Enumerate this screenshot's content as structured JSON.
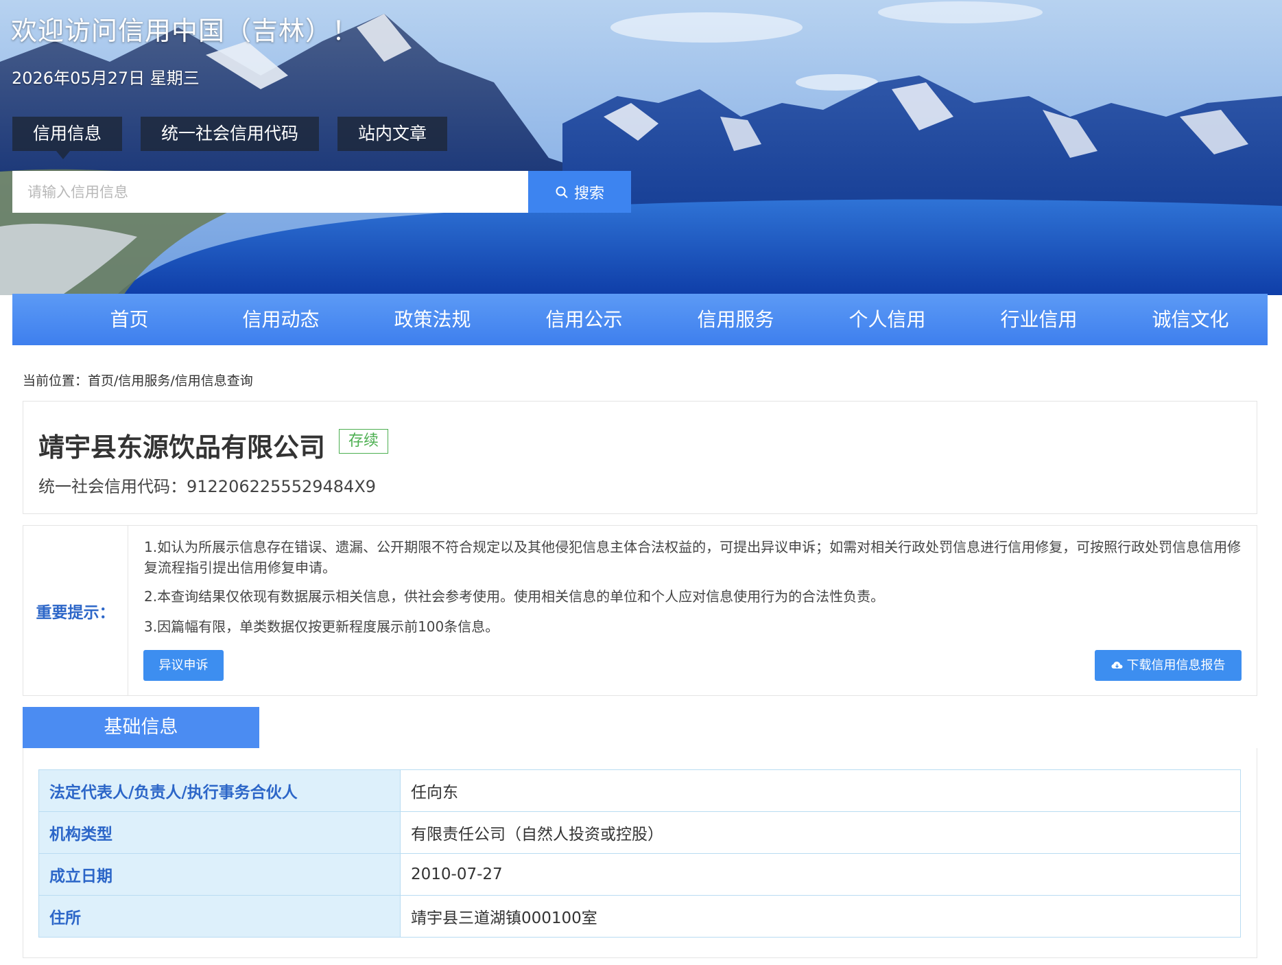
{
  "header": {
    "welcome": "欢迎访问信用中国（吉林）！",
    "date": "2026年05月27日 星期三"
  },
  "search": {
    "tabs": [
      {
        "label": "信用信息",
        "active": true
      },
      {
        "label": "统一社会信用代码",
        "active": false
      },
      {
        "label": "站内文章",
        "active": false
      }
    ],
    "placeholder": "请输入信用信息",
    "button_label": "搜索"
  },
  "nav": {
    "items": [
      "首页",
      "信用动态",
      "政策法规",
      "信用公示",
      "信用服务",
      "个人信用",
      "行业信用",
      "诚信文化"
    ]
  },
  "breadcrumb": "当前位置：首页/信用服务/信用信息查询",
  "company": {
    "name": "靖宇县东源饮品有限公司",
    "status": "存续",
    "credit_code_label": "统一社会信用代码：",
    "credit_code": "9122062255529484X9"
  },
  "notice": {
    "label": "重要提示：",
    "items": [
      "1.如认为所展示信息存在错误、遗漏、公开期限不符合规定以及其他侵犯信息主体合法权益的，可提出异议申诉；如需对相关行政处罚信息进行信用修复，可按照行政处罚信息信用修复流程指引提出信用修复申请。",
      "2.本查询结果仅依现有数据展示相关信息，供社会参考使用。使用相关信息的单位和个人应对信息使用行为的合法性负责。",
      "3.因篇幅有限，单类数据仅按更新程度展示前100条信息。"
    ],
    "appeal_button": "异议申诉",
    "download_button": "下载信用信息报告"
  },
  "basic_info": {
    "tab_label": "基础信息",
    "rows": [
      {
        "key": "法定代表人/负责人/执行事务合伙人",
        "value": "任向东"
      },
      {
        "key": "机构类型",
        "value": "有限责任公司（自然人投资或控股）"
      },
      {
        "key": "成立日期",
        "value": "2010-07-27"
      },
      {
        "key": "住所",
        "value": "靖宇县三道湖镇000100室"
      }
    ]
  },
  "icons": {
    "search": "search-icon",
    "download": "cloud-download-icon"
  },
  "colors": {
    "primary": "#3d84f0",
    "nav": "#4b8cf2",
    "label_blue": "#2c66c8",
    "status_green": "#4caf50",
    "table_key_bg": "#ddf0fb",
    "table_border": "#b9dcf2"
  }
}
